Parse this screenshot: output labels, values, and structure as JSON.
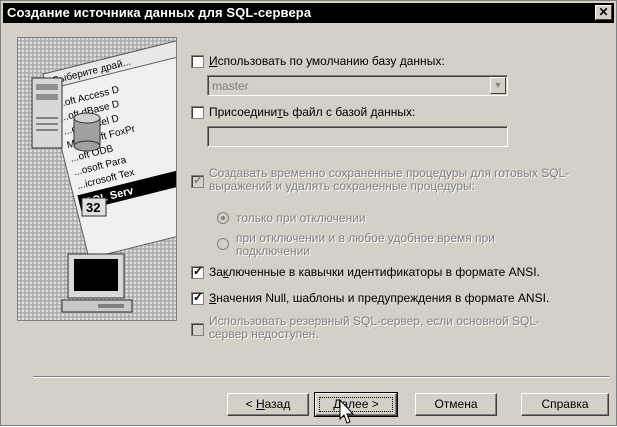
{
  "window": {
    "title": "Создание источника данных для SQL-сервера",
    "close_glyph": "✕"
  },
  "art": {
    "banner": "Выберите драй...",
    "list_items": [
      "...oft Access D",
      "...oft dBase D",
      "...oft Excel D",
      "Microsoft FoxPr",
      "...oft ODB",
      "...osoft Para",
      "...icrosoft Tex",
      "SQL Serv"
    ],
    "badge": "32"
  },
  "options": {
    "use_default_db": {
      "label_pre": "",
      "label_u": "И",
      "label_post": "спользовать по умолчанию базу данных:",
      "checked": false
    },
    "default_db_value": "master",
    "attach_file": {
      "label_pre": "Присоедини",
      "label_u": "т",
      "label_post": "ь файл с базой данных:",
      "checked": false
    },
    "attach_file_value": "",
    "create_temp_procs": {
      "label": "Создавать временно сохраненные процедуры для готовых SQL-выражений и удалять сохраненные процедуры:",
      "checked": true
    },
    "radio_on_disconnect": {
      "label": "только при отключении",
      "selected": true
    },
    "radio_on_disconnect_and_any": {
      "label": "при отключении и в любое удобное время при подключении",
      "selected": false
    },
    "quoted_identifiers": {
      "label_pre": "За",
      "label_u": "к",
      "label_post": "люченные в кавычки идентификаторы в формате ANSI.",
      "checked": true
    },
    "ansi_nulls": {
      "label_pre": "",
      "label_u": "З",
      "label_post": "начения Null, шаблоны и предупреждения в формате ANSI.",
      "checked": true
    },
    "failover_server": {
      "label": "Использовать резервный SQL-сервер, если основной SQL-сервер недоступен.",
      "checked": false
    }
  },
  "buttons": {
    "back": {
      "pre": "< ",
      "u": "Н",
      "post": "азад"
    },
    "next": {
      "pre": "",
      "u": "Д",
      "post": "алее >"
    },
    "cancel": "Отмена",
    "help": "Справка"
  }
}
